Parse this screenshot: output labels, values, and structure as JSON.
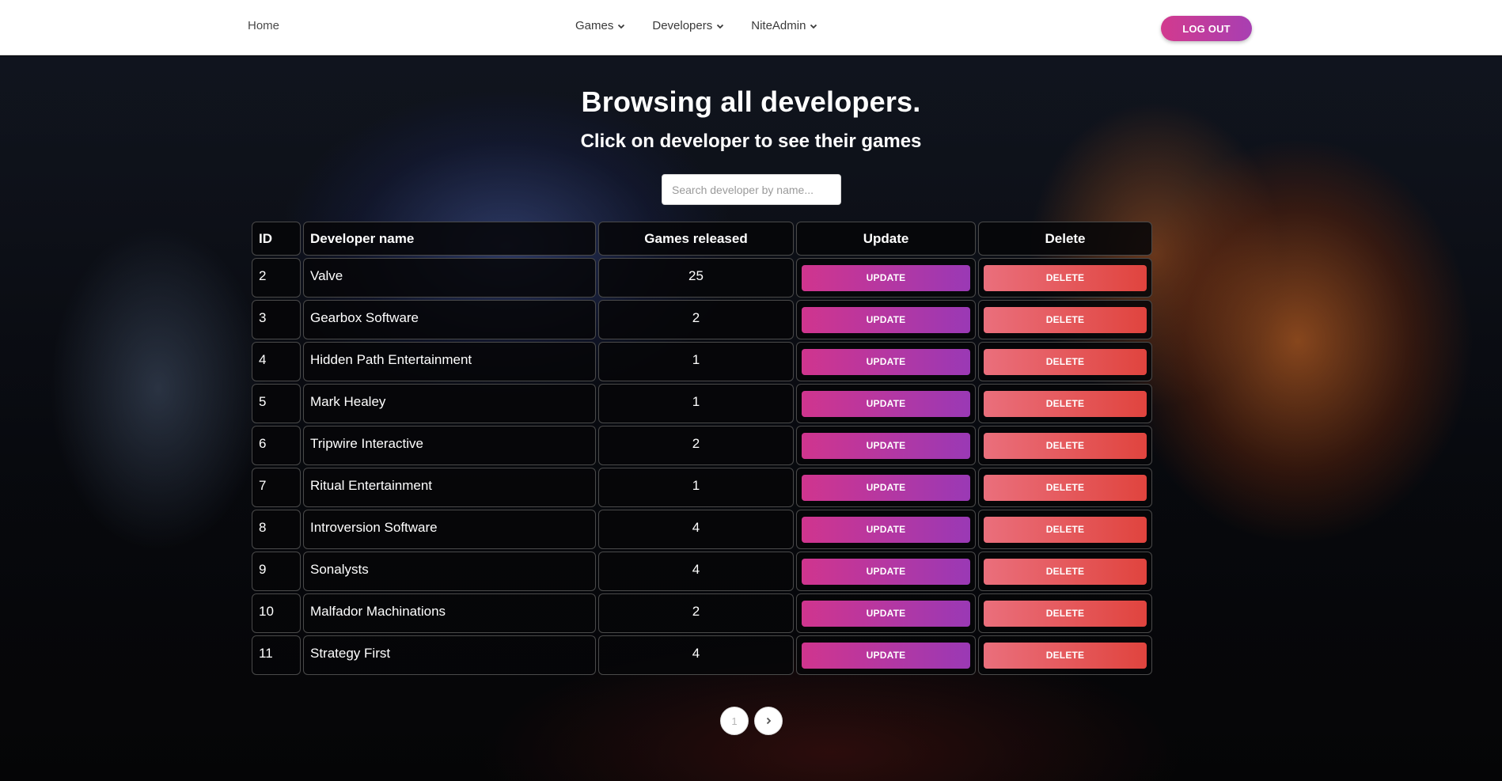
{
  "nav": {
    "home": "Home",
    "menus": [
      {
        "label": "Games"
      },
      {
        "label": "Developers"
      },
      {
        "label": "NiteAdmin"
      }
    ],
    "logout": "LOG OUT"
  },
  "header": {
    "title": "Browsing all developers.",
    "subtitle": "Click on developer to see their games"
  },
  "search": {
    "placeholder": "Search developer by name...",
    "value": ""
  },
  "table": {
    "columns": {
      "id": "ID",
      "name": "Developer name",
      "games": "Games released",
      "update": "Update",
      "delete": "Delete"
    },
    "update_label": "UPDATE",
    "delete_label": "DELETE",
    "rows": [
      {
        "id": "2",
        "name": "Valve",
        "games": "25"
      },
      {
        "id": "3",
        "name": "Gearbox Software",
        "games": "2"
      },
      {
        "id": "4",
        "name": "Hidden Path Entertainment",
        "games": "1"
      },
      {
        "id": "5",
        "name": "Mark Healey",
        "games": "1"
      },
      {
        "id": "6",
        "name": "Tripwire Interactive",
        "games": "2"
      },
      {
        "id": "7",
        "name": "Ritual Entertainment",
        "games": "1"
      },
      {
        "id": "8",
        "name": "Introversion Software",
        "games": "4"
      },
      {
        "id": "9",
        "name": "Sonalysts",
        "games": "4"
      },
      {
        "id": "10",
        "name": "Malfador Machinations",
        "games": "2"
      },
      {
        "id": "11",
        "name": "Strategy First",
        "games": "4"
      }
    ]
  },
  "pagination": {
    "current": "1",
    "next_icon": "chevron-right-icon"
  },
  "colors": {
    "accent_purple": "#d0358e",
    "accent_violet": "#9a39b5",
    "delete_red": "#e0443e"
  }
}
